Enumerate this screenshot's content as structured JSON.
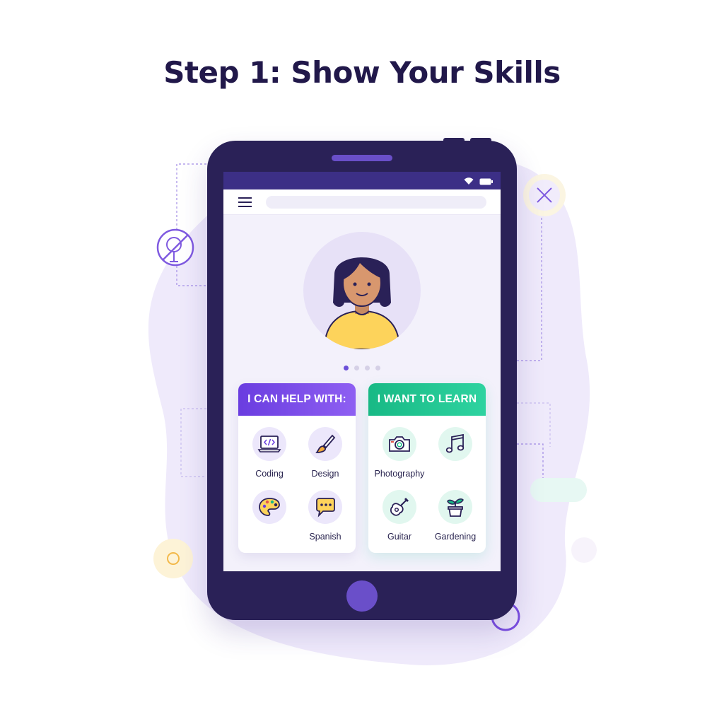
{
  "page": {
    "title": "Step 1: Show Your Skills"
  },
  "colors": {
    "title": "#21184a",
    "device": "#2a2157",
    "status_bar": "#3c2f86",
    "accent_purple": "#6a3de0",
    "accent_green": "#18b985",
    "active_dot": "#6b4fd8"
  },
  "profile": {
    "avatar_icon": "person-avatar",
    "carousel_total": 4,
    "carousel_active": 1
  },
  "help_card": {
    "header": "I CAN HELP WITH:",
    "items": [
      {
        "label": "Coding",
        "icon": "laptop-code-icon"
      },
      {
        "label": "Design",
        "icon": "paintbrush-icon"
      },
      {
        "label": "",
        "icon": "palette-icon"
      },
      {
        "label": "Spanish",
        "icon": "speech-bubble-icon"
      }
    ]
  },
  "learn_card": {
    "header": "I WANT TO LEARN",
    "items": [
      {
        "label": "Photography",
        "icon": "camera-icon"
      },
      {
        "label": "",
        "icon": "music-note-icon"
      },
      {
        "label": "Guitar",
        "icon": "guitar-icon"
      },
      {
        "label": "Gardening",
        "icon": "potted-plant-icon"
      }
    ]
  }
}
